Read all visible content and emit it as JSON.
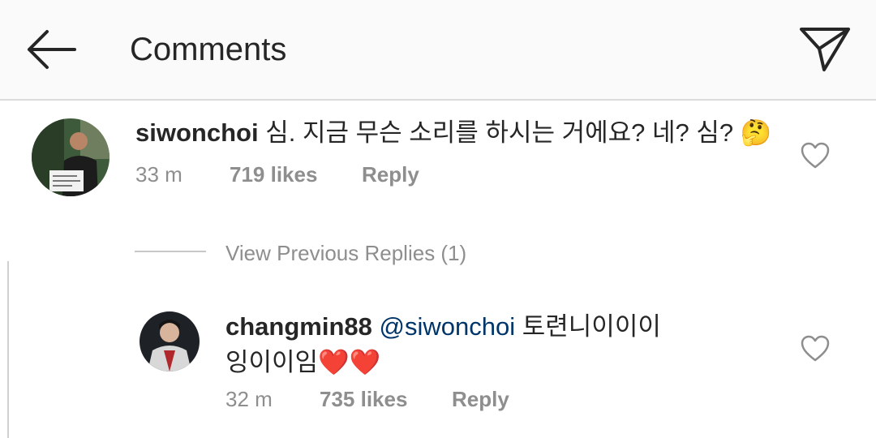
{
  "header": {
    "title": "Comments",
    "back_icon": "arrow-left-icon",
    "share_icon": "paper-plane-icon"
  },
  "comments": [
    {
      "username": "siwonchoi",
      "text": "심. 지금 무슨 소리를 하시는 거에요? 네? 심? 🤔",
      "time": "33 m",
      "likes": "719 likes",
      "reply": "Reply"
    }
  ],
  "view_previous_replies": "View Previous Replies (1)",
  "replies": [
    {
      "username": "changmin88",
      "mention": "@siwonchoi",
      "text_line1": "토련니이이이",
      "text_line2": "잉이이임❤️❤️",
      "time": "32 m",
      "likes": "735 likes",
      "reply": "Reply"
    }
  ],
  "colors": {
    "text": "#262626",
    "secondary": "#8e8e8e",
    "mention": "#003569",
    "header_bg": "#fafafa",
    "divider": "#dbdbdb"
  }
}
